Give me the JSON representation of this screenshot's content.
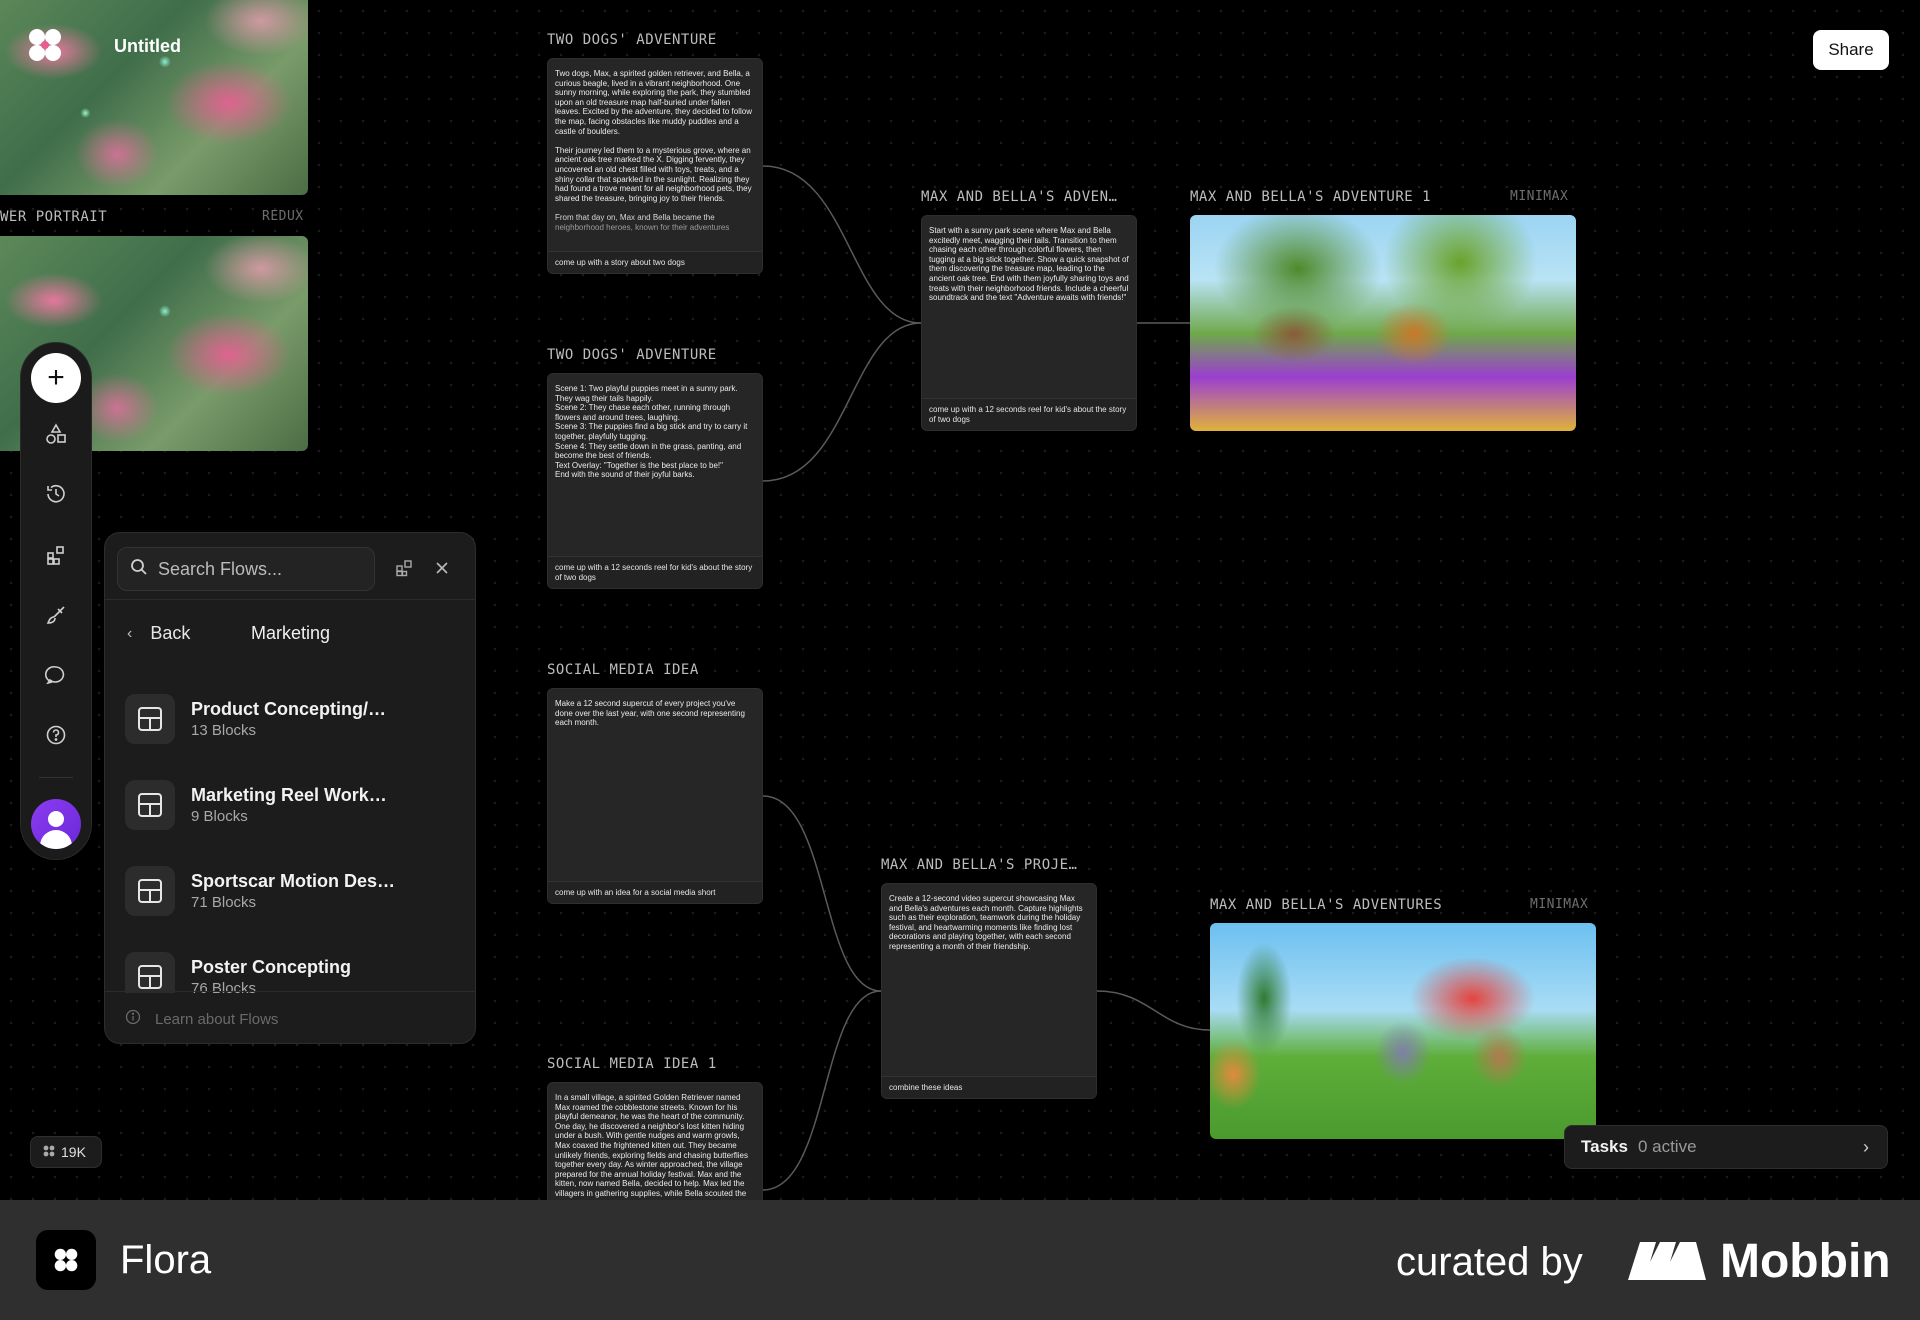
{
  "header": {
    "title": "Untitled",
    "share_label": "Share"
  },
  "nodes": {
    "flower_portrait": {
      "title": "WER PORTRAIT",
      "tag": "REDUX"
    },
    "two_dogs_1": {
      "title": "TWO DOGS' ADVENTURE",
      "body": "Two dogs, Max, a spirited golden retriever, and Bella, a curious beagle, lived in a vibrant neighborhood. One sunny morning, while exploring the park, they stumbled upon an old treasure map half-buried under fallen leaves. Excited by the adventure, they decided to follow the map, facing obstacles like muddy puddles and a castle of boulders.\n\nTheir journey led them to a mysterious grove, where an ancient oak tree marked the X. Digging fervently, they uncovered an old chest filled with toys, treats, and a shiny collar that sparkled in the sunlight. Realizing they had found a trove meant for all neighborhood pets, they shared the treasure, bringing joy to their friends.\n\nFrom that day on, Max and Bella became the neighborhood heroes, known for their adventures",
      "prompt": "come up with a story about two dogs"
    },
    "two_dogs_2": {
      "title": "TWO DOGS' ADVENTURE",
      "body": "Scene 1: Two playful puppies meet in a sunny park. They wag their tails happily.\nScene 2: They chase each other, running through flowers and around trees, laughing.\nScene 3: The puppies find a big stick and try to carry it together, playfully tugging.\nScene 4: They settle down in the grass, panting, and become the best of friends.\nText Overlay: \"Together is the best place to be!\"\nEnd with the sound of their joyful barks.",
      "prompt": "come up with a 12 seconds reel for kid's about the story of two dogs"
    },
    "max_bella_adv": {
      "title": "MAX AND BELLA'S ADVEN…",
      "body": "Start with a sunny park scene where Max and Bella excitedly meet, wagging their tails. Transition to them chasing each other through colorful flowers, then tugging at a big stick together. Show a quick snapshot of them discovering the treasure map, leading to the ancient oak tree. End with them joyfully sharing toys and treats with their neighborhood friends. Include a cheerful soundtrack and the text \"Adventure awaits with friends!\"",
      "prompt": "come up with a 12 seconds reel for kid's about the story of two dogs"
    },
    "max_bella_video_1": {
      "title": "MAX AND BELLA'S ADVENTURE 1",
      "tag": "MINIMAX"
    },
    "social_media": {
      "title": "SOCIAL MEDIA IDEA",
      "body": "Make a 12 second supercut of every project you've done over the last year, with one second representing each month.",
      "prompt": "come up with an idea for a social media short"
    },
    "max_bella_proj": {
      "title": "MAX AND BELLA'S PROJE…",
      "body": "Create a 12-second video supercut showcasing Max and Bella's adventures each month. Capture highlights such as their exploration, teamwork during the holiday festival, and heartwarming moments like finding lost decorations and playing together, with each second representing a month of their friendship.",
      "prompt": "combine these ideas"
    },
    "max_bella_videos": {
      "title": "MAX AND BELLA'S ADVENTURES",
      "tag": "MINIMAX"
    },
    "social_media_1": {
      "title": "SOCIAL MEDIA IDEA 1",
      "body": "In a small village, a spirited Golden Retriever named Max roamed the cobblestone streets. Known for his playful demeanor, he was the heart of the community. One day, he discovered a neighbor's lost kitten hiding under a bush. With gentle nudges and warm growls, Max coaxed the frightened kitten out. They became unlikely friends, exploring fields and chasing butterflies together every day. As winter approached, the village prepared for the annual holiday festival. Max and the kitten, now named Bella, decided to help. Max led the villagers in gathering supplies, while Bella scouted the nooks"
    }
  },
  "toolbar": {
    "tools": [
      "add-icon",
      "shapes-icon",
      "history-icon",
      "blocks-icon",
      "brush-icon",
      "chat-icon",
      "help-icon"
    ]
  },
  "flows_panel": {
    "search_placeholder": "Search Flows...",
    "back_label": "Back",
    "category": "Marketing",
    "items": [
      {
        "name": "Product Concepting/…",
        "count": "13 Blocks"
      },
      {
        "name": "Marketing Reel Work…",
        "count": "9 Blocks"
      },
      {
        "name": "Sportscar Motion Des…",
        "count": "71 Blocks"
      },
      {
        "name": "Poster Concepting",
        "count": "76 Blocks"
      }
    ],
    "footer_link": "Learn about Flows"
  },
  "credits": {
    "value": "19K"
  },
  "tasks": {
    "label": "Tasks",
    "status": "0 active"
  },
  "footer": {
    "app_name": "Flora",
    "curated_by": "curated by",
    "brand": "Mobbin"
  },
  "colors": {
    "accent_avatar": "#7b33e6",
    "canvas_bg": "#000000",
    "card_bg": "#262626"
  }
}
